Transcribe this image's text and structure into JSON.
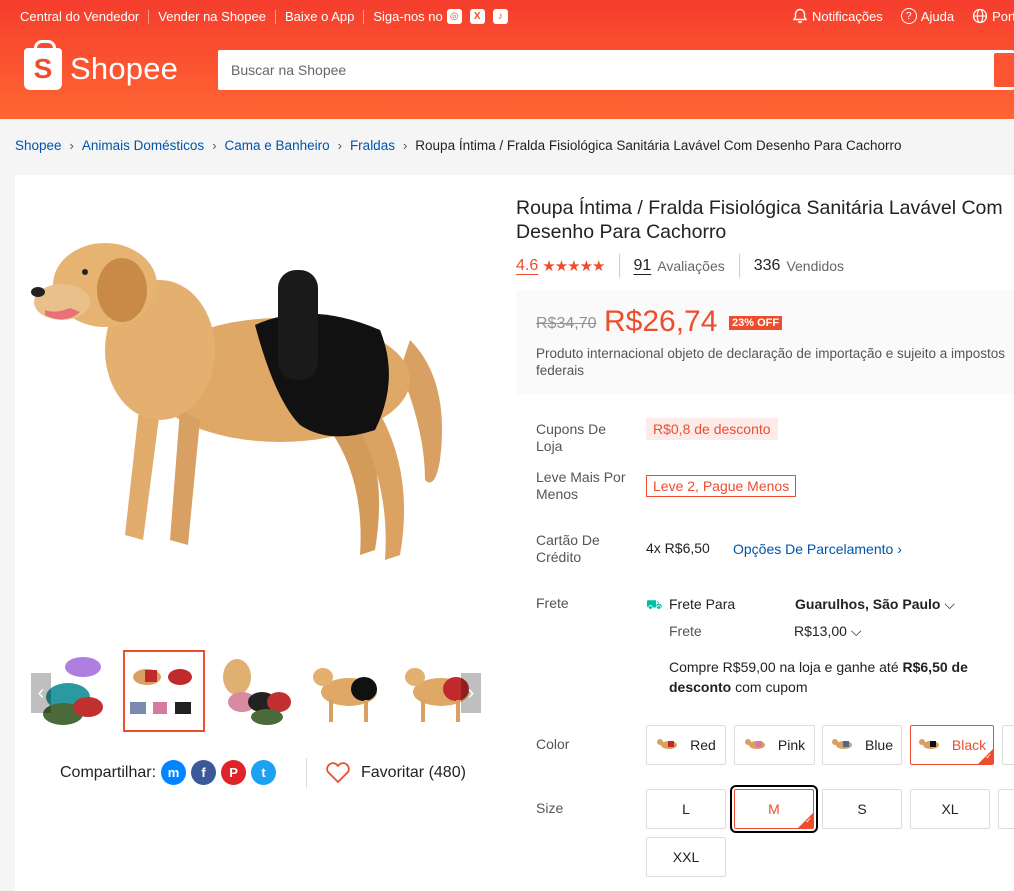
{
  "header": {
    "top_left": [
      "Central do Vendedor",
      "Vender na Shopee",
      "Baixe o App",
      "Siga-nos no"
    ],
    "social_icons": [
      "instagram-icon",
      "x-icon",
      "tiktok-icon"
    ],
    "notifications": "Notificações",
    "help": "Ajuda",
    "language": "Portu",
    "logo_text": "Shopee",
    "search_placeholder": "Buscar na Shopee"
  },
  "breadcrumb": {
    "items": [
      "Shopee",
      "Animais Domésticos",
      "Cama e Banheiro",
      "Fraldas"
    ],
    "current": "Roupa Íntima / Fralda Fisiológica Sanitária Lavável Com Desenho Para Cachorro"
  },
  "product": {
    "title": "Roupa Íntima / Fralda Fisiológica Sanitária Lavável Com Desenho Para Cachorro",
    "rating": "4.6",
    "stars": "★★★★★",
    "reviews_count": "91",
    "reviews_label": "Avaliações",
    "sold_count": "336",
    "sold_label": "Vendidos",
    "old_price": "R$34,70",
    "price": "R$26,74",
    "discount": "23% OFF",
    "price_note": "Produto internacional objeto de declaração de importação e sujeito a impostos federais"
  },
  "details": {
    "coupons_label": "Cupons De Loja",
    "coupon_tag": "R$0,8 de desconto",
    "bundle_label": "Leve Mais Por Menos",
    "bundle_tag": "Leve 2, Pague Menos",
    "card_label": "Cartão De Crédito",
    "installments": "4x R$6,50",
    "installment_options": "Opções De Parcelamento",
    "shipping_label": "Frete",
    "shipping_to_label": "Frete Para",
    "shipping_to_value": "Guarulhos, São Paulo",
    "shipping_cost_label": "Frete",
    "shipping_cost_value": "R$13,00",
    "promo_text_1": "Compre R$59,00 na loja e ganhe até ",
    "promo_bold": "R$6,50 de desconto",
    "promo_text_2": " com cupom"
  },
  "variants": {
    "color_label": "Color",
    "colors": [
      "Red",
      "Pink",
      "Blue",
      "Black"
    ],
    "selected_color": "Black",
    "size_label": "Size",
    "sizes": [
      "L",
      "M",
      "S",
      "XL",
      "XXL"
    ],
    "selected_size": "M"
  },
  "share": {
    "label": "Compartilhar:",
    "icons": [
      "messenger-icon",
      "facebook-icon",
      "pinterest-icon",
      "twitter-icon"
    ],
    "favorite": "Favoritar (480)"
  },
  "colors": {
    "brand": "#ee4d2d",
    "link": "#0055aa"
  }
}
